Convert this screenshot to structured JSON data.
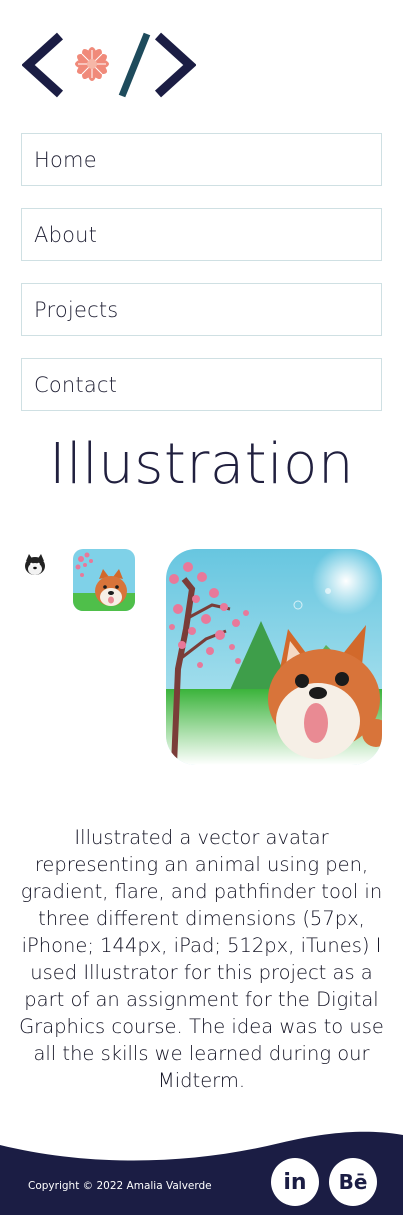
{
  "brand": {
    "logo_icon": "code-brackets-flower-logo",
    "colors": {
      "navy": "#1b1d44",
      "flower": "#f08a7a",
      "accent_teal": "#1e4b5c",
      "nav_border": "#cfe0e3"
    }
  },
  "nav": {
    "items": [
      {
        "label": "Home"
      },
      {
        "label": "About"
      },
      {
        "label": "Projects"
      },
      {
        "label": "Contact"
      }
    ]
  },
  "page": {
    "title": "Illustration",
    "description": "Illustrated a vector avatar representing an animal using pen, gradient, flare, and pathfinder tool in three different dimensions (57px, iPhone; 144px, iPad; 512px, iTunes) I used Illustrator for this project as a part of an assignment for the Digital Graphics course. The idea was to use all the skills we learned during our Midterm."
  },
  "gallery": {
    "images": [
      {
        "name": "shiba-avatar-small"
      },
      {
        "name": "shiba-avatar-medium"
      },
      {
        "name": "shiba-avatar-large"
      }
    ]
  },
  "footer": {
    "copyright": "Copyright © 2022 Amalia Valverde",
    "social": [
      {
        "label": "in",
        "icon": "linkedin-icon"
      },
      {
        "label": "Bē",
        "icon": "behance-icon"
      }
    ]
  }
}
